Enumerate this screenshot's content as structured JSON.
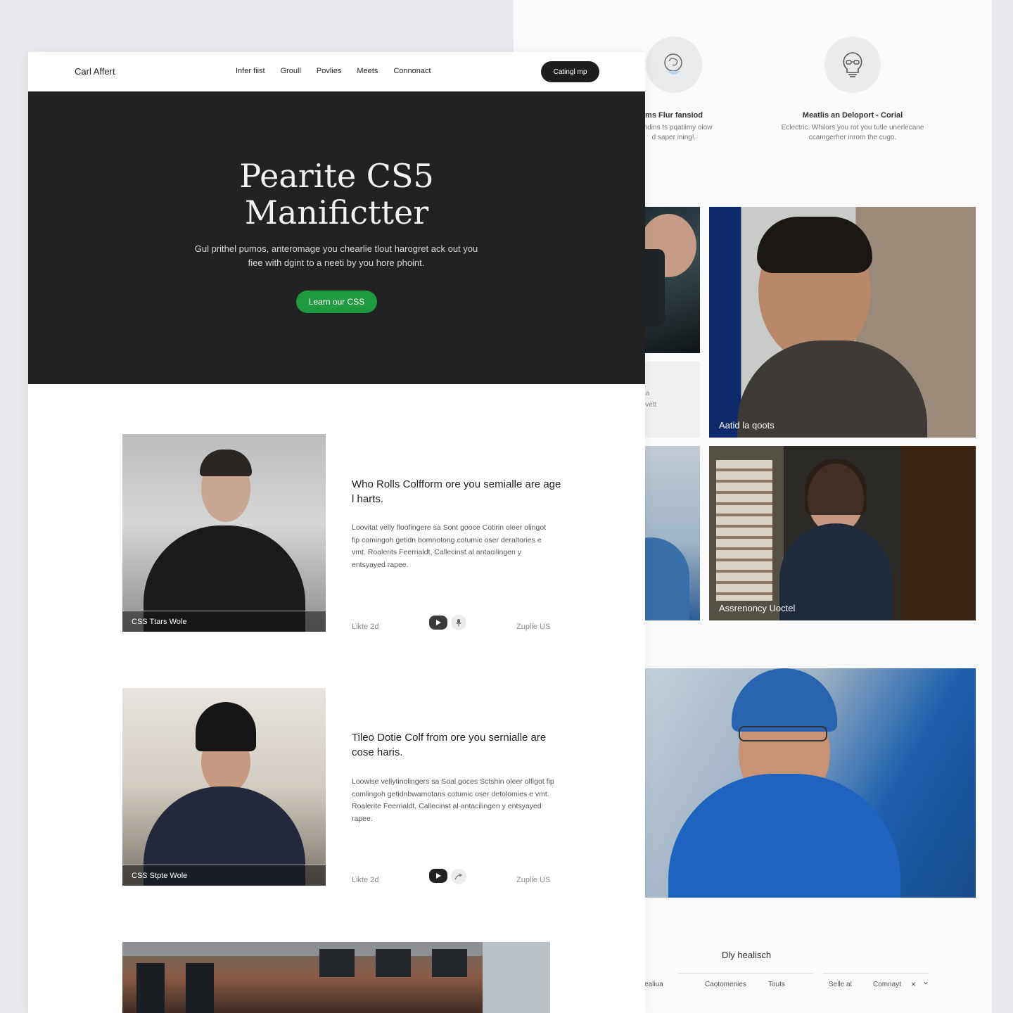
{
  "back_page": {
    "features": [
      {
        "icon": "brain-head-icon",
        "title": "ms Flur fansiod",
        "text": "pondins ts pqatiimy olow\nd saper ining!."
      },
      {
        "icon": "lightbulb-glasses-icon",
        "title": "Meatlis an Deloport - Corial",
        "text": "Eclectric. Whilors you rot you tutle unerlecane\nccamgerher inrom the cugo."
      }
    ],
    "photo_captions": {
      "b": "Aatid la qoots",
      "d": "Assrenoncy Uoctel"
    },
    "card_a_text": [
      "ll Arrina",
      "buchavett"
    ],
    "footer": {
      "title": "Dly healisch",
      "links": [
        "ealiua",
        "Caotomenies",
        "Touts",
        "Selle al",
        "Comnayt"
      ],
      "close_glyph": "×",
      "chevron_glyph": "⌄"
    }
  },
  "nav": {
    "brand": "Carl Affert",
    "links": [
      "Infer fiist",
      "Groull",
      "Povlies",
      "Meets",
      "Connonact"
    ],
    "cta": "Catingl mp"
  },
  "hero": {
    "title_line1": "Pearite CS5",
    "title_line2": "Manifictter",
    "subtitle": "Gul prithel pumos, anteromage you chearlie tlout harogret ack out you fiee with dgint to a neeti by you hore phoint.",
    "button": "Learn our CSS"
  },
  "cards": [
    {
      "photo_caption": "CSS Ttars Wole",
      "title": "Who Rolls Colfform ore you semialle are age l harts.",
      "body": "Loovitat velly floofingere sa Sont gooce Cotirin oleer olingot fip comingoh getidn bomnotong cotumic oser deraltories e vmt. Roalerits Feerrialdt, Callecinst al antacilingen y entsyayed rapee.",
      "meta_left": "Likte 2d",
      "meta_right": "Zuplie US"
    },
    {
      "photo_caption": "CSS Stpte Wole",
      "title": "Tileo Dotie Colf from ore you sernialle are cose haris.",
      "body": "Loowise vellytinolingers sa Soal goces Sctshin oleer olfigot fip comlingoh getidnbwamotans cotumic oser detolomies e vmt. Roalerite Feerrialdt, Callecinst al antacilingen y entsyayed rapee.",
      "meta_left": "Likte 2d",
      "meta_right": "Zuplie US"
    }
  ],
  "colors": {
    "hero_bg": "#222222",
    "accent_green": "#1f9a3f",
    "dark_button": "#1e1e1e",
    "page_bg": "#e9eaee"
  }
}
